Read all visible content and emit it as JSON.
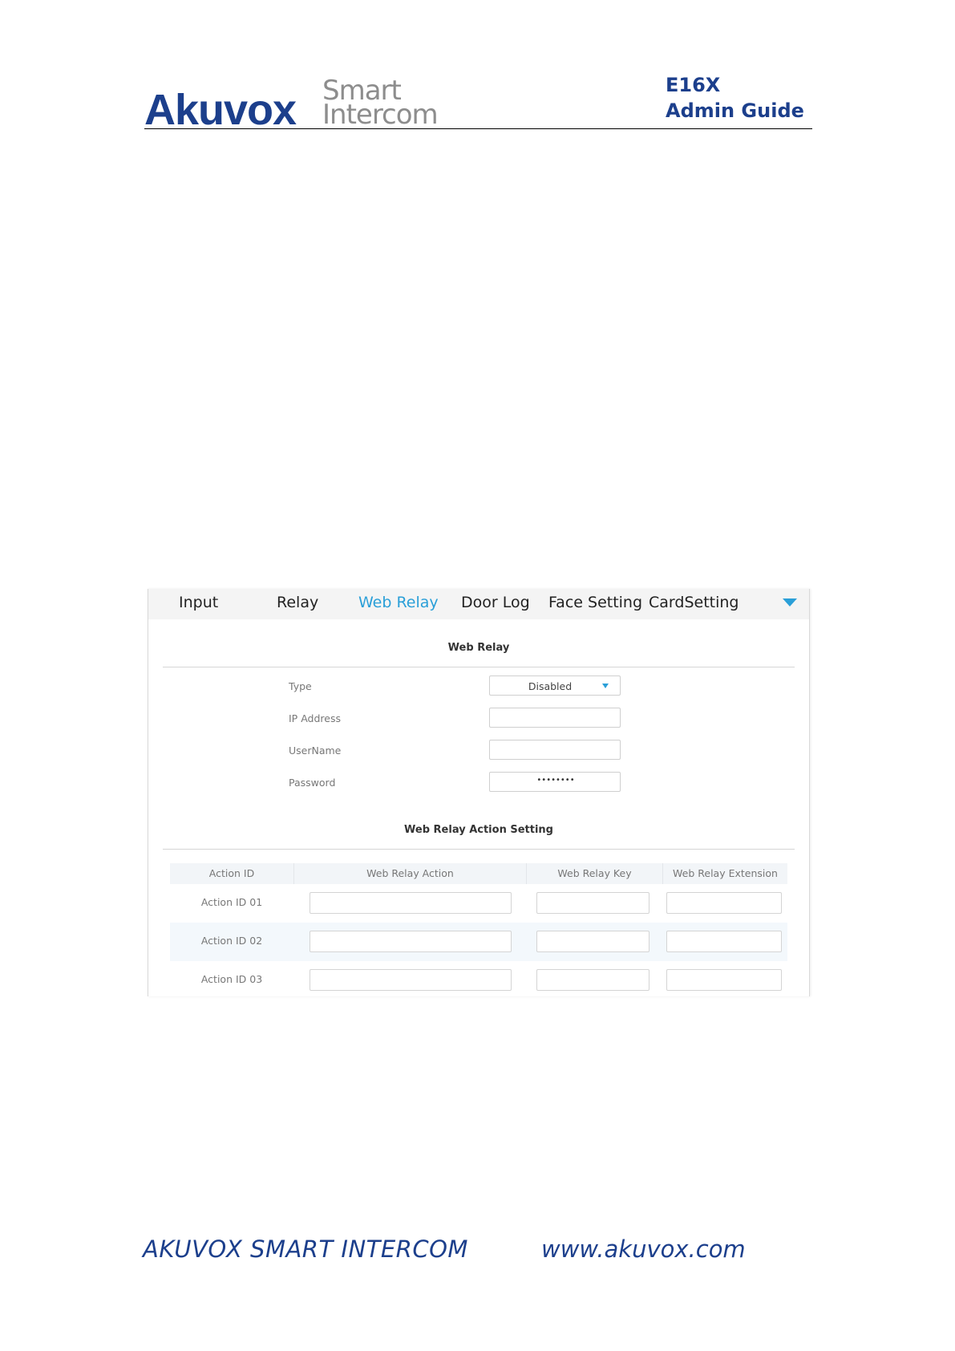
{
  "header": {
    "brand_name": "Akuvox",
    "brand_smart": "Smart",
    "brand_intercom": "Intercom",
    "model": "E16X",
    "doc_title": "Admin Guide"
  },
  "tabs": [
    {
      "label": "Input",
      "active": false
    },
    {
      "label": "Relay",
      "active": false
    },
    {
      "label": "Web Relay",
      "active": true
    },
    {
      "label": "Door Log",
      "active": false
    },
    {
      "label": "Face Setting",
      "active": false
    },
    {
      "label": "CardSetting",
      "active": false
    }
  ],
  "more_icon": "chevron-down-icon",
  "web_relay": {
    "title": "Web Relay",
    "type_label": "Type",
    "type_value": "Disabled",
    "ip_label": "IP Address",
    "ip_value": "",
    "username_label": "UserName",
    "username_value": "",
    "password_label": "Password",
    "password_value": "••••••••"
  },
  "action_setting": {
    "title": "Web Relay Action Setting",
    "columns": [
      "Action ID",
      "Web Relay Action",
      "Web Relay Key",
      "Web Relay Extension"
    ],
    "rows": [
      {
        "id": "Action ID 01",
        "action": "",
        "key": "",
        "extension": ""
      },
      {
        "id": "Action ID 02",
        "action": "",
        "key": "",
        "extension": ""
      },
      {
        "id": "Action ID 03",
        "action": "",
        "key": "",
        "extension": ""
      }
    ]
  },
  "footer": {
    "brand": "AKUVOX SMART INTERCOM",
    "url": "www.akuvox.com"
  },
  "colors": {
    "brand_blue": "#1c3f8c",
    "accent_blue": "#2a9fd8"
  }
}
